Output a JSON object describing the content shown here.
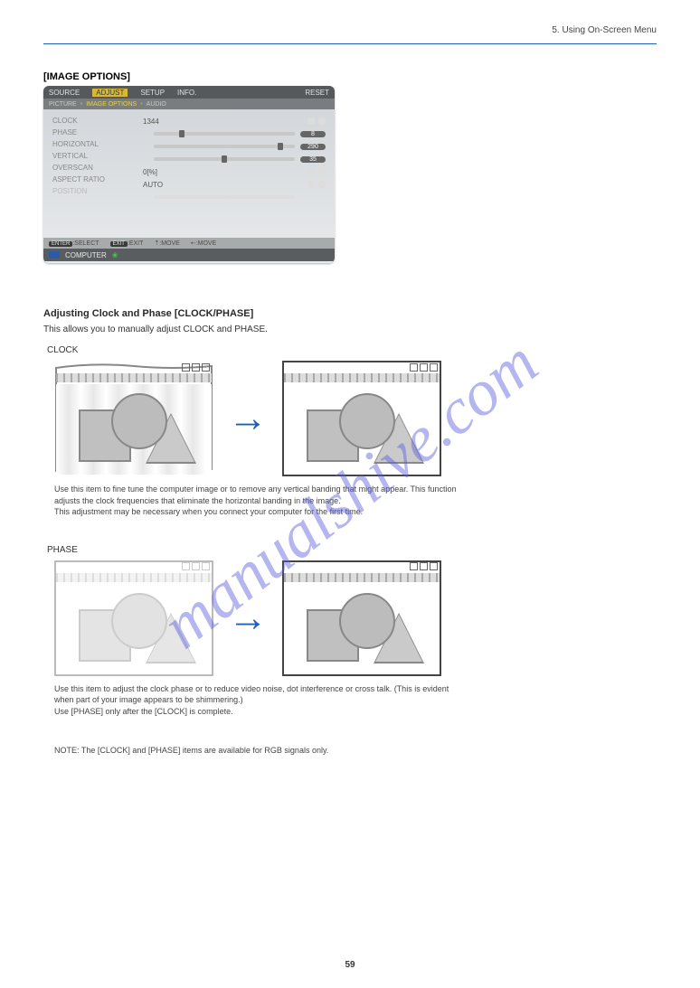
{
  "breadcrumb": "5. Using On-Screen Menu",
  "section_title": "[IMAGE OPTIONS]",
  "osd": {
    "tabs": {
      "source": "SOURCE",
      "adjust": "ADJUST",
      "setup": "SETUP",
      "info": "INFO.",
      "reset": "RESET"
    },
    "subtabs": {
      "picture": "PICTURE",
      "image_options": "IMAGE OPTIONS",
      "audio": "AUDIO"
    },
    "items": {
      "clock": {
        "label": "CLOCK",
        "value": "1344"
      },
      "phase": {
        "label": "PHASE",
        "value": "8"
      },
      "horizontal": {
        "label": "HORIZONTAL",
        "value": "290"
      },
      "vertical": {
        "label": "VERTICAL",
        "value": "35"
      },
      "overscan": {
        "label": "OVERSCAN",
        "value": "0[%]"
      },
      "aspect_ratio": {
        "label": "ASPECT RATIO",
        "value": "AUTO"
      },
      "position": {
        "label": "POSITION"
      }
    },
    "footer1": {
      "enter": "ENTER",
      "select": ":SELECT",
      "exit": "EXIT",
      "exit_lbl": ":EXIT",
      "move1": "⇡:MOVE",
      "move2": "⇠:MOVE"
    },
    "footer2": {
      "computer": "COMPUTER"
    }
  },
  "clock_section": {
    "heading": "Adjusting Clock and Phase [CLOCK/PHASE]",
    "subtitle": "This allows you to manually adjust CLOCK and PHASE.",
    "clock_label": "CLOCK",
    "clock_desc1": "Use this item to fine tune the computer image or to remove any vertical banding that might appear. This function",
    "clock_desc2": "adjusts the clock frequencies that eliminate the horizontal banding in the image.",
    "clock_desc3": "This adjustment may be necessary when you connect your computer for the first time.",
    "phase_label": "PHASE",
    "phase_desc1": "Use this item to adjust the clock phase or to reduce video noise, dot interference or cross talk. (This is evident",
    "phase_desc2": "when part of your image appears to be shimmering.)",
    "phase_desc3": "Use [PHASE] only after the [CLOCK] is complete.",
    "note_label": "NOTE: The [CLOCK] and [PHASE] items are available for RGB signals only."
  },
  "watermark": "manualshive.com",
  "page_number": "59"
}
